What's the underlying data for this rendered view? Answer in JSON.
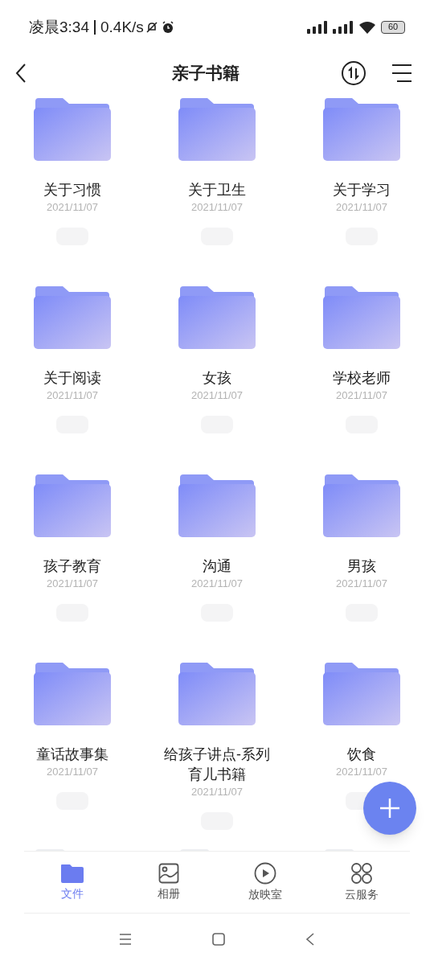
{
  "status_bar": {
    "time": "凌晨3:34",
    "speed": "0.4K/s",
    "battery": "60"
  },
  "header": {
    "title": "亲子书籍"
  },
  "items": [
    {
      "kind": "folder",
      "name": "关于习惯",
      "date": "2021/11/07"
    },
    {
      "kind": "folder",
      "name": "关于卫生",
      "date": "2021/11/07"
    },
    {
      "kind": "folder",
      "name": "关于学习",
      "date": "2021/11/07"
    },
    {
      "kind": "folder",
      "name": "关于阅读",
      "date": "2021/11/07"
    },
    {
      "kind": "folder",
      "name": "女孩",
      "date": "2021/11/07"
    },
    {
      "kind": "folder",
      "name": "学校老师",
      "date": "2021/11/07"
    },
    {
      "kind": "folder",
      "name": "孩子教育",
      "date": "2021/11/07"
    },
    {
      "kind": "folder",
      "name": "沟通",
      "date": "2021/11/07"
    },
    {
      "kind": "folder",
      "name": "男孩",
      "date": "2021/11/07"
    },
    {
      "kind": "folder",
      "name": "童话故事集",
      "date": "2021/11/07"
    },
    {
      "kind": "folder",
      "name": "给孩子讲点-系列育儿书籍",
      "date": "2021/11/07"
    },
    {
      "kind": "folder",
      "name": "饮食",
      "date": "2021/11/07"
    },
    {
      "kind": "loading"
    },
    {
      "kind": "loading"
    },
    {
      "kind": "loading"
    }
  ],
  "tabs": [
    {
      "kind": "files",
      "label": "文件",
      "selected": true
    },
    {
      "kind": "album",
      "label": "相册",
      "selected": false
    },
    {
      "kind": "player",
      "label": "放映室",
      "selected": false
    },
    {
      "kind": "cloud",
      "label": "云服务",
      "selected": false
    }
  ]
}
